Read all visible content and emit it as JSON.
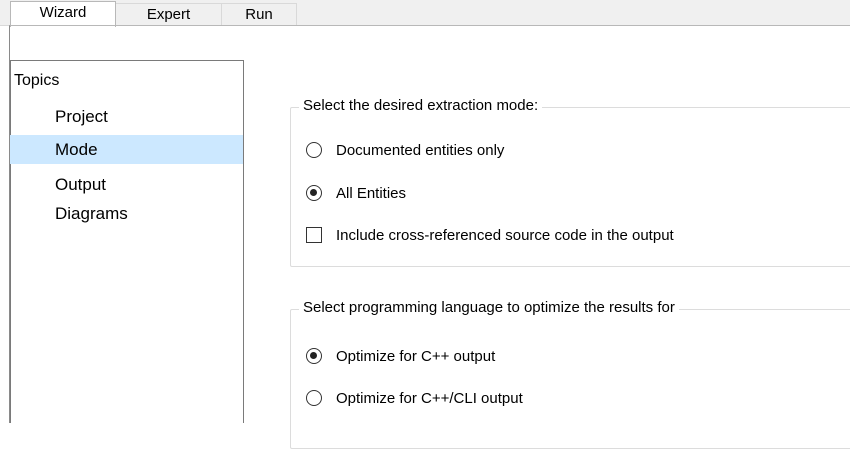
{
  "tabs": [
    {
      "label": "Wizard",
      "active": true
    },
    {
      "label": "Expert",
      "active": false
    },
    {
      "label": "Run",
      "active": false
    }
  ],
  "sidebar": {
    "title": "Topics",
    "items": [
      {
        "label": "Project",
        "selected": false
      },
      {
        "label": "Mode",
        "selected": true
      },
      {
        "label": "Output",
        "selected": false
      },
      {
        "label": "Diagrams",
        "selected": false
      }
    ]
  },
  "extraction": {
    "legend": "Select the desired extraction mode:",
    "options": [
      {
        "label": "Documented entities only",
        "checked": false
      },
      {
        "label": "All Entities",
        "checked": true
      }
    ],
    "crossref": {
      "label": "Include cross-referenced source code in the output",
      "checked": false
    }
  },
  "language": {
    "legend": "Select programming language to optimize the results for",
    "options": [
      {
        "label": "Optimize for C++ output",
        "checked": true
      },
      {
        "label": "Optimize for C++/CLI output",
        "checked": false
      }
    ]
  },
  "colors": {
    "selection": "#cce8ff",
    "tabbar": "#f0f0f0",
    "border": "#7a7a7a"
  }
}
